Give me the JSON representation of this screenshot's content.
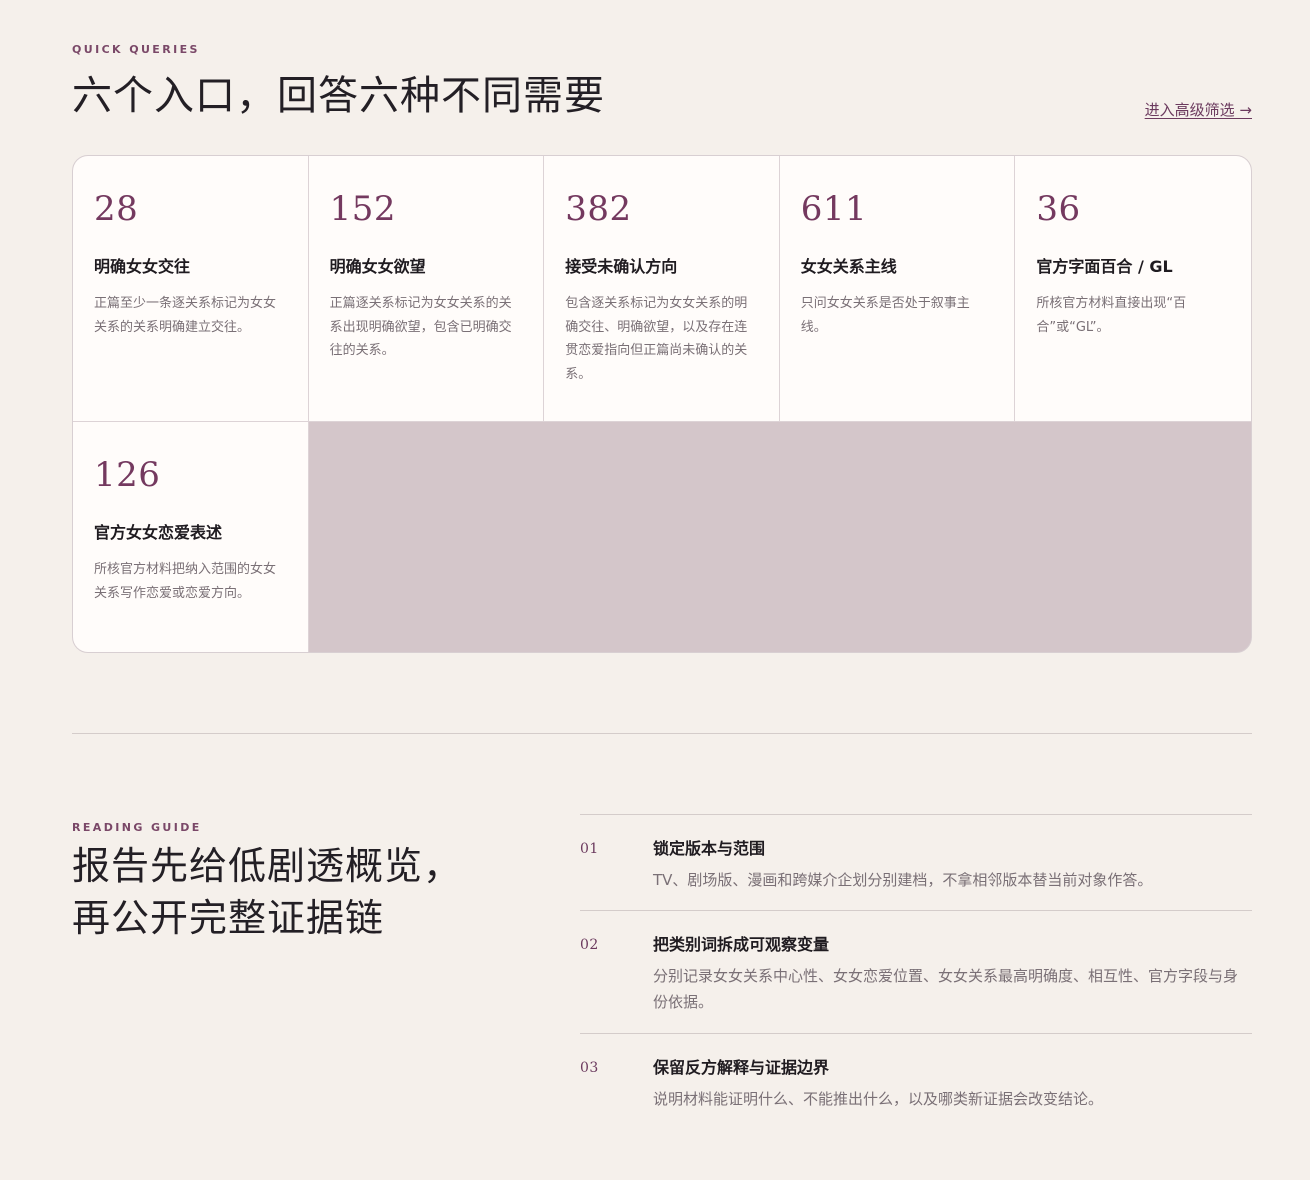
{
  "quick_queries": {
    "eyebrow": "QUICK QUERIES",
    "title": "六个入口，回答六种不同需要",
    "advanced_link": "进入高级筛选 →",
    "cards": [
      {
        "count": "28",
        "title": "明确女女交往",
        "desc": "正篇至少一条逐关系标记为女女关系的关系明确建立交往。"
      },
      {
        "count": "152",
        "title": "明确女女欲望",
        "desc": "正篇逐关系标记为女女关系的关系出现明确欲望，包含已明确交往的关系。"
      },
      {
        "count": "382",
        "title": "接受未确认方向",
        "desc": "包含逐关系标记为女女关系的明确交往、明确欲望，以及存在连贯恋爱指向但正篇尚未确认的关系。"
      },
      {
        "count": "611",
        "title": "女女关系主线",
        "desc": "只问女女关系是否处于叙事主线。"
      },
      {
        "count": "36",
        "title": "官方字面百合 / GL",
        "desc": "所核官方材料直接出现“百合”或“GL”。"
      },
      {
        "count": "126",
        "title": "官方女女恋爱表述",
        "desc": "所核官方材料把纳入范围的女女关系写作恋爱或恋爱方向。"
      }
    ]
  },
  "reading_guide": {
    "eyebrow": "READING GUIDE",
    "title_line1": "报告先给低剧透概览，",
    "title_line2": "再公开完整证据链",
    "steps": [
      {
        "num": "01",
        "title": "锁定版本与范围",
        "desc": "TV、剧场版、漫画和跨媒介企划分别建档，不拿相邻版本替当前对象作答。"
      },
      {
        "num": "02",
        "title": "把类别词拆成可观察变量",
        "desc": "分别记录女女关系中心性、女女恋爱位置、女女关系最高明确度、相互性、官方字段与身份依据。"
      },
      {
        "num": "03",
        "title": "保留反方解释与证据边界",
        "desc": "说明材料能证明什么、不能推出什么，以及哪类新证据会改变结论。"
      }
    ]
  }
}
